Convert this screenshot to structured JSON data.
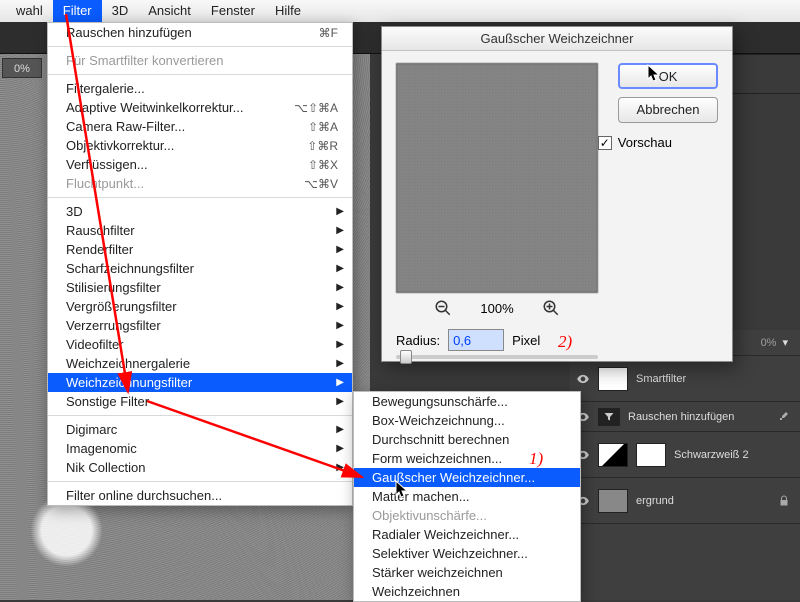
{
  "menubar": {
    "items": [
      "wahl",
      "Filter",
      "3D",
      "Ansicht",
      "Fenster",
      "Hilfe"
    ],
    "active_index": 1
  },
  "options_bar": {
    "zoom": "0%"
  },
  "menu_filter": {
    "recent": {
      "label": "Rauschen hinzufügen",
      "shortcut": "⌘F"
    },
    "convert": "Für Smartfilter konvertieren",
    "gallery": "Filtergalerie...",
    "wideangle": {
      "label": "Adaptive Weitwinkelkorrektur...",
      "shortcut": "⌥⇧⌘A"
    },
    "cameraraw": {
      "label": "Camera Raw-Filter...",
      "shortcut": "⇧⌘A"
    },
    "lens": {
      "label": "Objektivkorrektur...",
      "shortcut": "⇧⌘R"
    },
    "liquify": {
      "label": "Verflüssigen...",
      "shortcut": "⇧⌘X"
    },
    "vanish": {
      "label": "Fluchtpunkt...",
      "shortcut": "⌥⌘V"
    },
    "subs": [
      "3D",
      "Rauschfilter",
      "Renderfilter",
      "Scharfzeichnungsfilter",
      "Stilisierungsfilter",
      "Vergrößerungsfilter",
      "Verzerrungsfilter",
      "Videofilter",
      "Weichzeichnergalerie",
      "Weichzeichnungsfilter",
      "Sonstige Filter"
    ],
    "plugins": [
      "Digimarc",
      "Imagenomic",
      "Nik Collection"
    ],
    "browse": "Filter online durchsuchen..."
  },
  "submenu_blur": {
    "items": [
      "Bewegungsunschärfe...",
      "Box-Weichzeichnung...",
      "Durchschnitt berechnen",
      "Form weichzeichnen...",
      "Gaußscher Weichzeichner...",
      "Matter machen...",
      "Objektivunschärfe...",
      "Radialer Weichzeichner...",
      "Selektiver Weichzeichner...",
      "Stärker weichzeichnen",
      "Weichzeichnen"
    ],
    "highlight_index": 4,
    "disabled_index": 6
  },
  "dialog": {
    "title": "Gaußscher Weichzeichner",
    "ok": "OK",
    "cancel": "Abbrechen",
    "preview_checkbox": "Vorschau",
    "preview_checked": true,
    "zoom_label": "100%",
    "radius_label": "Radius:",
    "radius_value": "0,6",
    "radius_unit": "Pixel"
  },
  "layers": {
    "opacity_label": "0%",
    "rows": [
      {
        "label": "Smartfilter"
      },
      {
        "label": "Rauschen hinzufügen"
      },
      {
        "label": "Schwarzweiß 2"
      },
      {
        "label": "ergrund"
      }
    ]
  },
  "annotations": {
    "step1": "1)",
    "step2": "2)"
  }
}
